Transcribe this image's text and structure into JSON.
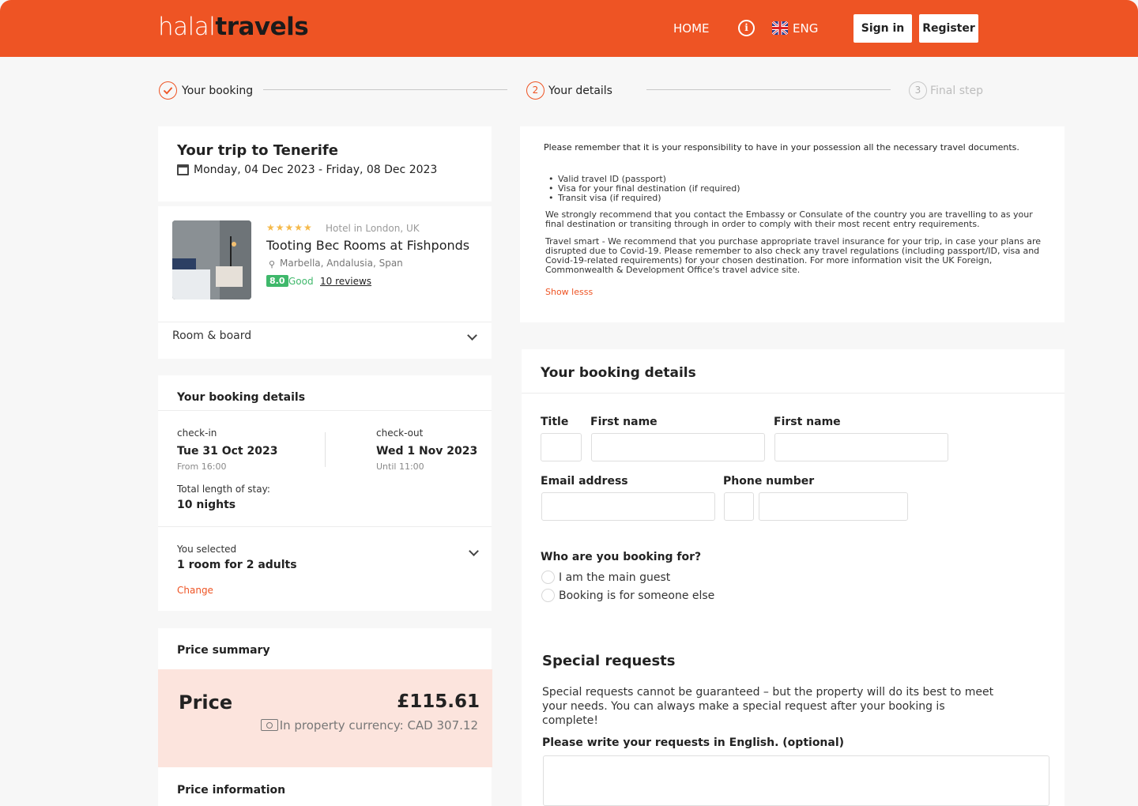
{
  "header": {
    "logo_light": "halal",
    "logo_bold": "travels",
    "nav_home": "HOME",
    "language": "ENG",
    "signin_label": "Sign in",
    "register_label": "Register",
    "brand_color": "#ee5424"
  },
  "stepper": {
    "steps": [
      {
        "label": "Your booking",
        "state": "completed"
      },
      {
        "number": "2",
        "label": "Your details",
        "state": "active"
      },
      {
        "number": "3",
        "label": "Final step",
        "state": "upcoming"
      }
    ]
  },
  "trip": {
    "title": "Your trip to Tenerife",
    "dates": "Monday, 04 Dec 2023 - Friday, 08 Dec 2023"
  },
  "hotel": {
    "stars": "★★★★★",
    "type": "Hotel in London, UK",
    "name": "Tooting Bec Rooms at Fishponds",
    "location": "Marbella, Andalusia, Span",
    "score": "8.0",
    "score_word": "Good",
    "reviews": "10 reviews",
    "room_board_label": "Room & board"
  },
  "booking_summary": {
    "title": "Your booking details",
    "checkin_label": "check-in",
    "checkin_date": "Tue 31 Oct 2023",
    "checkin_time": "From 16:00",
    "checkout_label": "check-out",
    "checkout_date": "Wed 1 Nov 2023",
    "checkout_time": "Until 11:00",
    "stay_label": "Total length of stay:",
    "stay_value": "10 nights",
    "selected_label": "You selected",
    "selected_value": "1 room for 2 adults",
    "change_label": "Change"
  },
  "price": {
    "summary_title": "Price summary",
    "label": "Price",
    "value": "£115.61",
    "property_currency": "In property currency: CAD 307.12",
    "info_title": "Price information"
  },
  "notice": {
    "heading": "Please remember that it is your responsibility to have in your possession all the necessary travel documents.",
    "documents": [
      "Valid travel ID (passport)",
      "Visa for your final destination (if required)",
      "Transit visa (if required)"
    ],
    "paragraph1": "We strongly recommend that you contact the Embassy or Consulate of the country you are travelling to as your final destination or transiting through in order to comply with their most recent entry requirements.",
    "paragraph2": "Travel smart - We recommend that you purchase appropriate travel insurance for your trip, in case your plans are disrupted due to Covid-19. Please remember to also check any travel regulations (including passport/ID, visa and Covid-19-related requirements) for your chosen destination. For more information visit the UK Foreign, Commonwealth & Development Office's travel advice site.",
    "show_less": "Show lesss"
  },
  "form": {
    "title": "Your booking details",
    "title_label": "Title",
    "first_name_label": "First name",
    "second_name_label": "First name",
    "email_label": "Email address",
    "phone_label": "Phone number",
    "booking_for_label": "Who are you booking for?",
    "option_main_guest": "I am the main guest",
    "option_someone_else": "Booking is for someone else"
  },
  "special_requests": {
    "title": "Special requests",
    "text": "Special requests cannot be guaranteed – but the property will do its best to meet your needs. You can always make a special request after your booking is complete!",
    "label": "Please write your requests in English. (optional)"
  }
}
